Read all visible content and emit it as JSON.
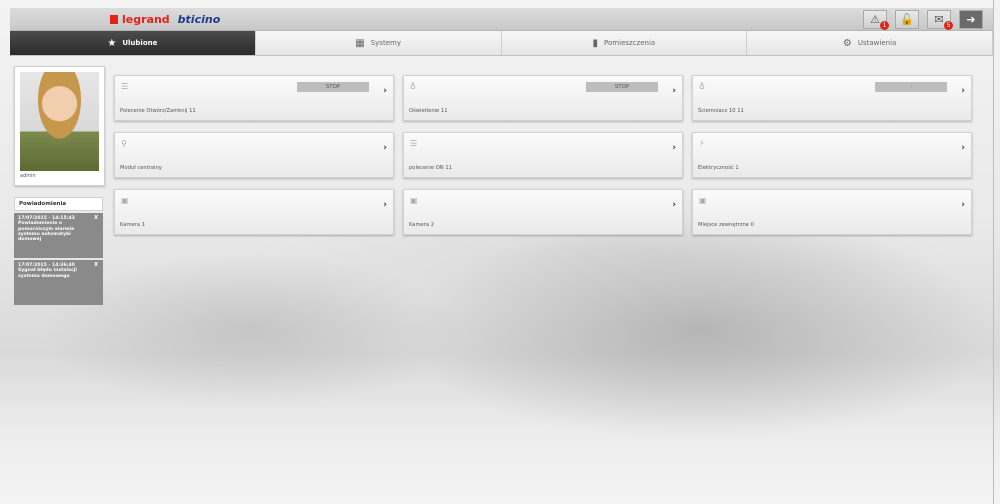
{
  "brand": {
    "logo_legrand": "legrand",
    "logo_bticino": "bticino"
  },
  "top_icons": [
    {
      "name": "alarm-icon",
      "glyph": "⚠",
      "badge": "1"
    },
    {
      "name": "lock-icon",
      "glyph": "🔓",
      "badge": ""
    },
    {
      "name": "mail-icon",
      "glyph": "✉",
      "badge": "5"
    },
    {
      "name": "logout-icon",
      "glyph": "➜",
      "badge": ""
    }
  ],
  "tabs": [
    {
      "label": "Ulubione",
      "icon": "★"
    },
    {
      "label": "Systemy",
      "icon": "▦"
    },
    {
      "label": "Pomieszczenia",
      "icon": "▮"
    },
    {
      "label": "Ustawienia",
      "icon": "⚙"
    }
  ],
  "profile": {
    "username": "admin"
  },
  "notifications": {
    "title": "Powiadomienia",
    "items": [
      {
        "text": "17/07/2015 - 14:15:43 Powiadomienie o pomocniczym alarmie systemu automatyki domowej",
        "close": "X"
      },
      {
        "text": "17/07/2015 - 14:36:40 Sygnał błędu instalacji systemu domowego",
        "close": "X"
      }
    ]
  },
  "cards": [
    {
      "label": "Polecenie Otwórz/Zamknij 11",
      "icon": "shutter-icon",
      "glyph": "☰",
      "status": "STOP",
      "chevron": "›"
    },
    {
      "label": "Oświetlenie 11",
      "icon": "light-bulb-icon",
      "glyph": "♁",
      "status": "STOP",
      "chevron": "›"
    },
    {
      "label": "Ściemniacz 10 11",
      "icon": "dimmer-icon",
      "glyph": "♁",
      "status": "-",
      "chevron": "›"
    },
    {
      "label": "Moduł centralny",
      "icon": "thermometer-icon",
      "glyph": "⚲",
      "status": "",
      "chevron": "›"
    },
    {
      "label": "polecenie ON 11",
      "icon": "command-icon",
      "glyph": "☰",
      "status": "",
      "chevron": "›"
    },
    {
      "label": "Elektryczność 1",
      "icon": "energy-icon",
      "glyph": "⚡",
      "status": "",
      "chevron": "›"
    },
    {
      "label": "Kamera 1",
      "icon": "camera-icon",
      "glyph": "▣",
      "status": "",
      "chevron": "›"
    },
    {
      "label": "Kamera 2",
      "icon": "camera-icon",
      "glyph": "▣",
      "status": "",
      "chevron": "›"
    },
    {
      "label": "Miejsce zewnętrzne 0",
      "icon": "outdoor-station-icon",
      "glyph": "▣",
      "status": "",
      "chevron": "›"
    }
  ],
  "colors": {
    "accent": "#e2231a",
    "brand_blue": "#1f3d8a",
    "active_tab": "#2f2f2f",
    "badge": "#d9261c"
  }
}
